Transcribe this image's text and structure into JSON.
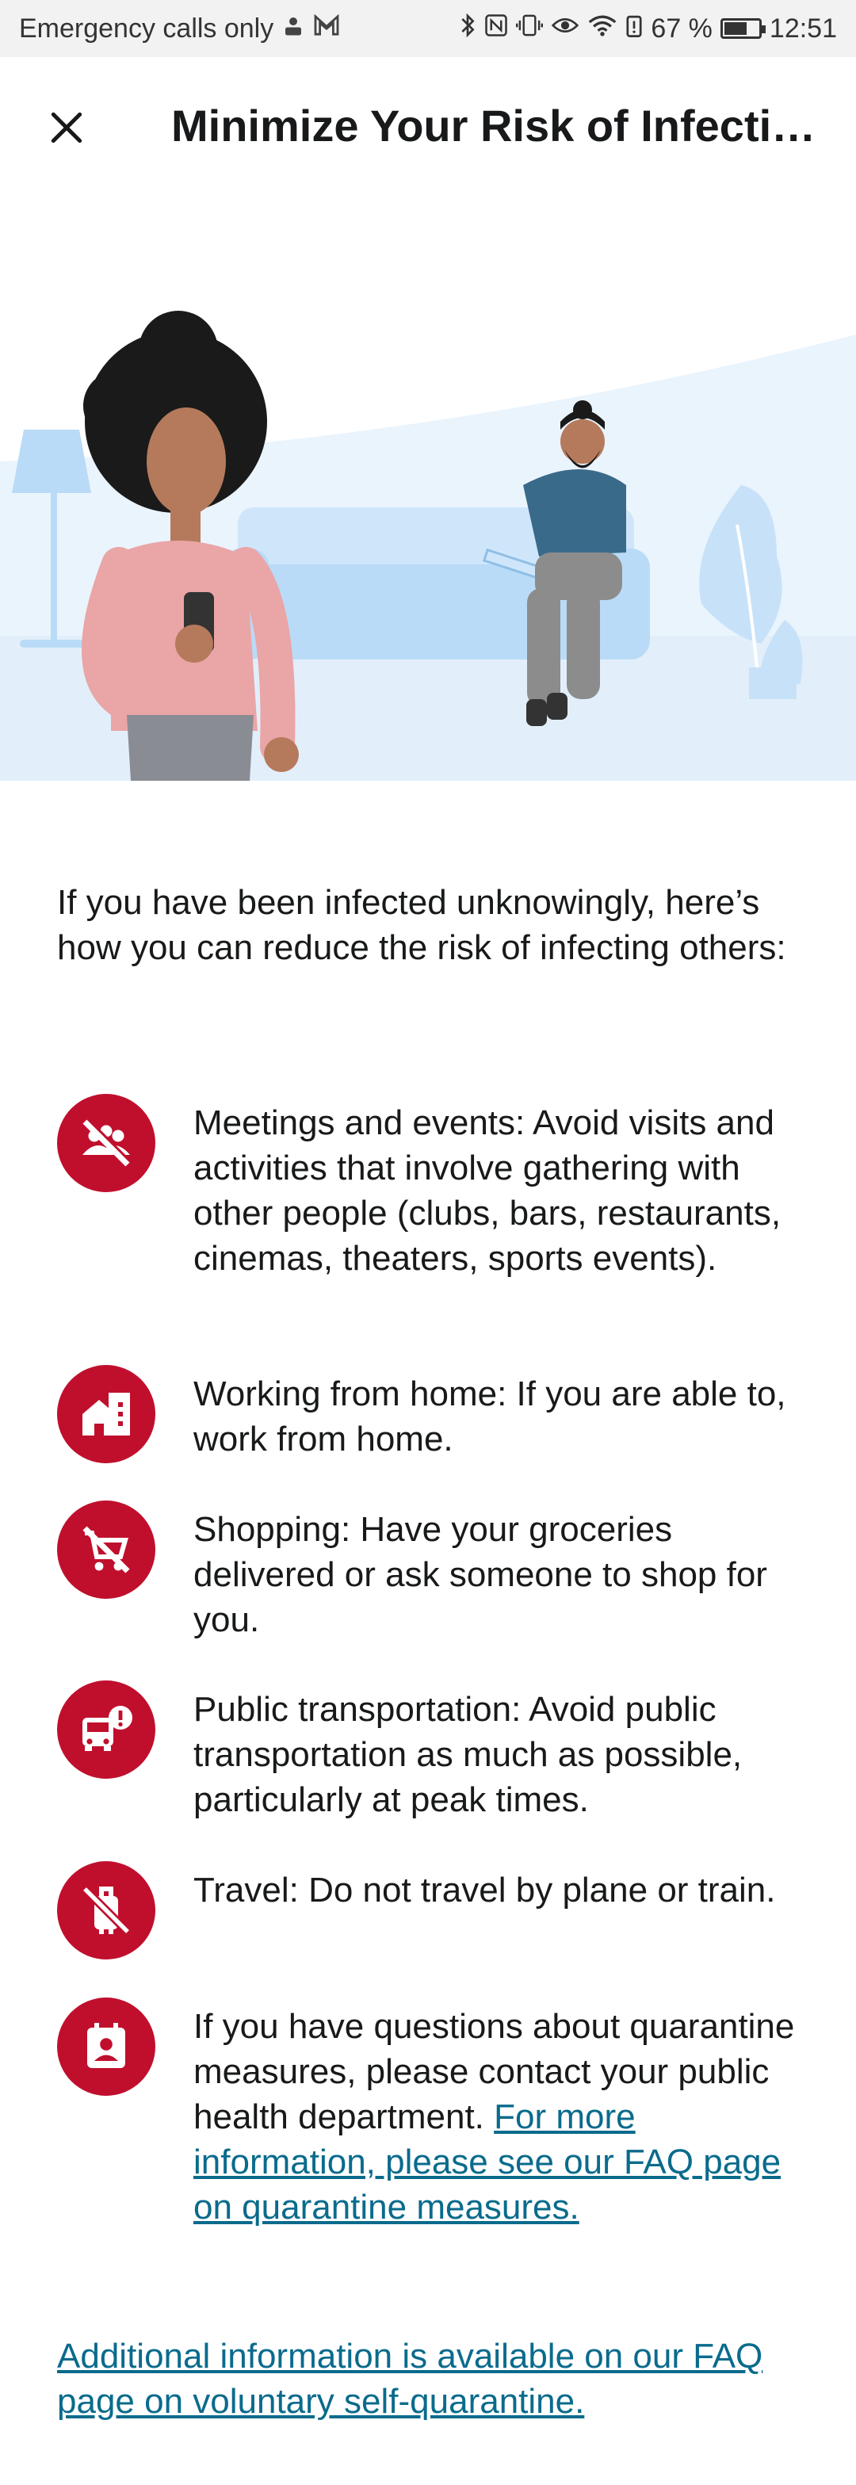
{
  "status_bar": {
    "left_text": "Emergency calls only",
    "battery_percent": "67 %",
    "time": "12:51",
    "icons": [
      "account-icon",
      "gmail-icon",
      "bluetooth-icon",
      "nfc-icon",
      "vibrate-icon",
      "eye-icon",
      "wifi-icon",
      "battery-alert-icon",
      "battery-icon"
    ]
  },
  "header": {
    "title": "Minimize Your Risk of Infecti…",
    "close_icon": "close-icon"
  },
  "illustration": {
    "name": "people-at-home-illustration",
    "colors": {
      "background": "#e6f2fc",
      "sofa": "#b9dbf7",
      "skin_woman": "#b57a5c",
      "shirt_woman": "#eaa5a6",
      "hair": "#1a1a1a",
      "shirt_man": "#3a6a8a",
      "pants_man": "#8c8c8c"
    }
  },
  "content": {
    "intro": "If you have been infected unknowingly, here’s how you can reduce the risk of infecting others:",
    "rules": [
      {
        "icon": "no-gathering-icon",
        "text": "Meetings and events: Avoid visits and activities that involve gathering with other people (clubs, bars, restaurants, cinemas, theaters, sports events)."
      },
      {
        "icon": "home-work-icon",
        "text": "Working from home: If you are able to, work from home."
      },
      {
        "icon": "no-shopping-cart-icon",
        "text": "Shopping: Have your groceries delivered or ask someone to shop for you."
      },
      {
        "icon": "bus-alert-icon",
        "text": "Public transportation: Avoid public transportation as much as possible, particularly at peak times."
      },
      {
        "icon": "no-luggage-icon",
        "text": "Travel: Do not travel by plane or train."
      },
      {
        "icon": "contact-card-icon",
        "text": "If you have questions about quarantine measures, please contact your public health department. ",
        "link": "For more information, please see our FAQ page on quarantine measures."
      }
    ],
    "bottom_link": "Additional information is available on our FAQ page on voluntary self-quarantine."
  },
  "colors": {
    "accent_red": "#c00f2d",
    "link": "#0a6b8c",
    "text": "#17191a"
  }
}
